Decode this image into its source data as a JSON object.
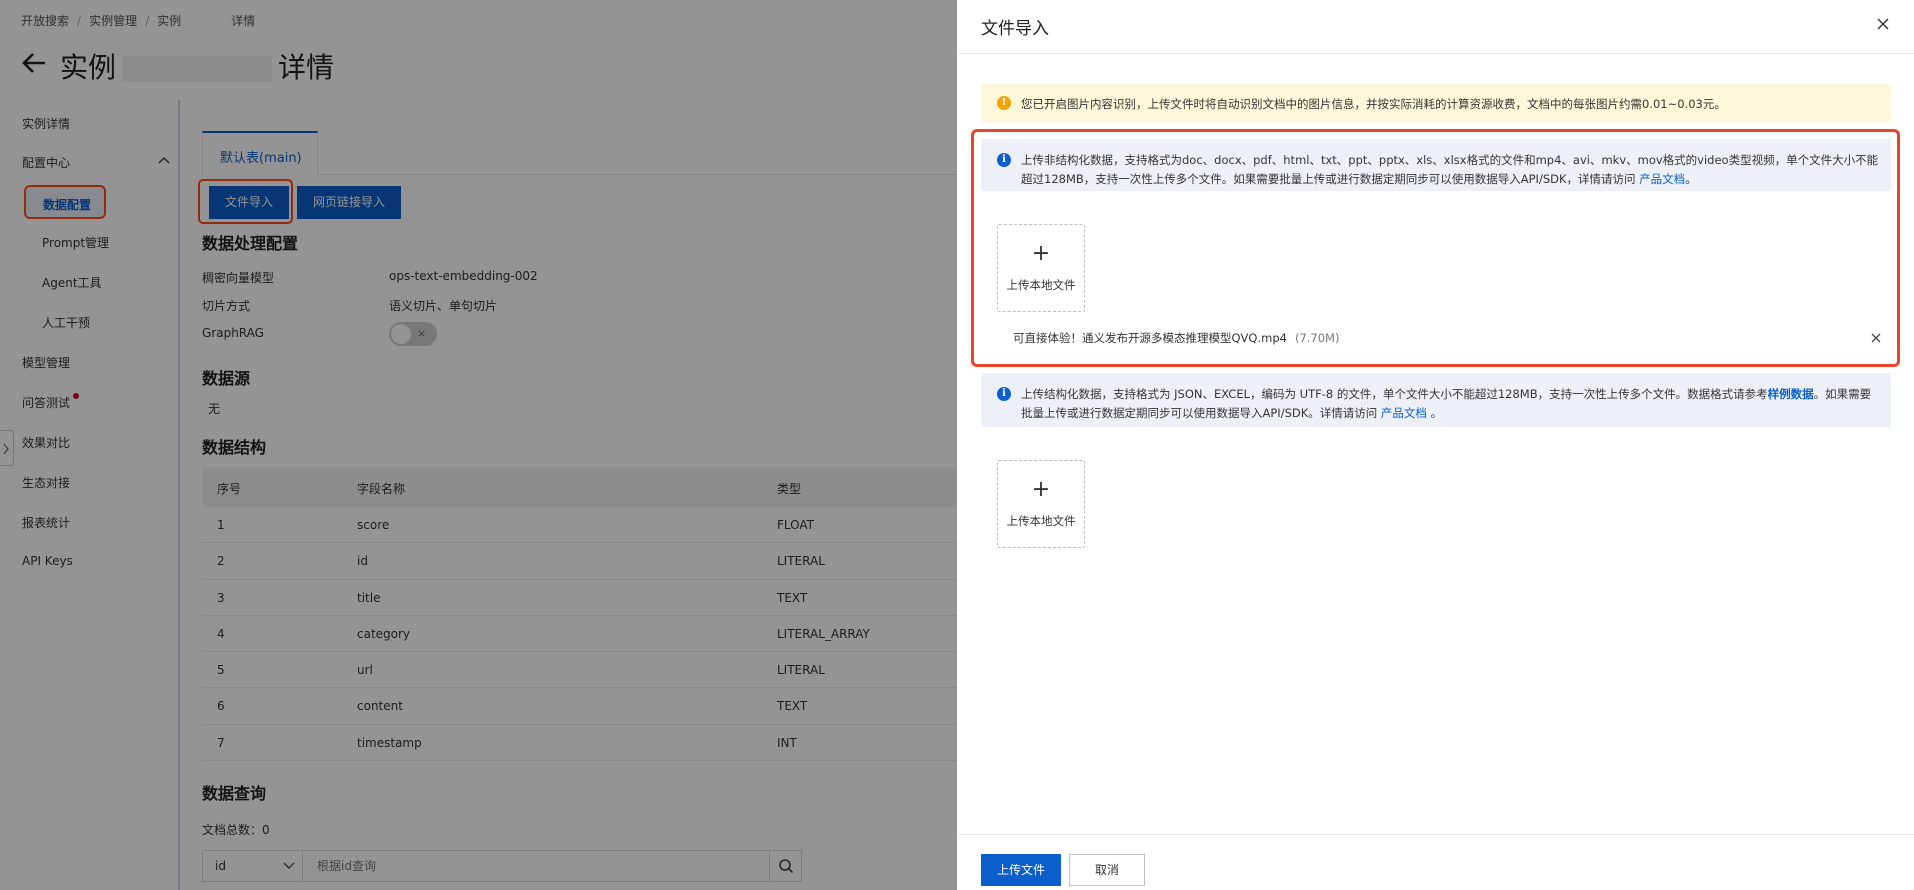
{
  "breadcrumb": [
    "开放搜索",
    "实例管理",
    "实例",
    "详情"
  ],
  "page_title": {
    "prefix": "实例",
    "suffix": "详情"
  },
  "sidebar": {
    "items": [
      {
        "label": "实例详情"
      },
      {
        "label": "配置中心"
      },
      {
        "label": "数据配置"
      },
      {
        "label": "Prompt管理"
      },
      {
        "label": "Agent工具"
      },
      {
        "label": "人工干预"
      },
      {
        "label": "模型管理"
      },
      {
        "label": "问答测试"
      },
      {
        "label": "效果对比"
      },
      {
        "label": "生态对接"
      },
      {
        "label": "报表统计"
      },
      {
        "label": "API Keys"
      }
    ]
  },
  "tabs": {
    "main": "默认表(main)"
  },
  "toolbar": {
    "file_import": "文件导入",
    "web_import": "网页链接导入"
  },
  "processing": {
    "title": "数据处理配置",
    "rows": [
      {
        "label": "稠密向量模型",
        "value": "ops-text-embedding-002"
      },
      {
        "label": "切片方式",
        "value": "语义切片、单句切片"
      },
      {
        "label": "GraphRAG",
        "value": ""
      }
    ],
    "switch_off_glyph": "×"
  },
  "datasource": {
    "title": "数据源",
    "value": "无"
  },
  "structure": {
    "title": "数据结构",
    "columns": [
      "序号",
      "字段名称",
      "类型"
    ],
    "rows": [
      [
        "1",
        "score",
        "FLOAT"
      ],
      [
        "2",
        "id",
        "LITERAL"
      ],
      [
        "3",
        "title",
        "TEXT"
      ],
      [
        "4",
        "category",
        "LITERAL_ARRAY"
      ],
      [
        "5",
        "url",
        "LITERAL"
      ],
      [
        "6",
        "content",
        "TEXT"
      ],
      [
        "7",
        "timestamp",
        "INT"
      ]
    ]
  },
  "query": {
    "title": "数据查询",
    "doc_count_label": "文档总数：0",
    "select_value": "id",
    "input_placeholder": "根据id查询"
  },
  "drawer": {
    "title": "文件导入",
    "warning": "您已开启图片内容识别，上传文件时将自动识别文档中的图片信息，并按实际消耗的计算资源收费，文档中的每张图片约需0.01~0.03元。",
    "unstructured": {
      "text": "上传非结构化数据，支持格式为doc、docx、pdf、html、txt、ppt、pptx、xls、xlsx格式的文件和mp4、avi、mkv、mov格式的video类型视频，单个文件大小不能超过128MB，支持一次性上传多个文件。如果需要批量上传或进行数据定期同步可以使用数据导入API/SDK，详情请访问",
      "link": "产品文档",
      "end": "。"
    },
    "upload_label": "上传本地文件",
    "upload_plus": "+",
    "file": {
      "name": "可直接体验！通义发布开源多模态推理模型QVQ.mp4",
      "size": "(7.70M)"
    },
    "structured": {
      "text": "上传结构化数据，支持格式为 JSON、EXCEL，编码为 UTF-8 的文件，单个文件大小不能超过128MB，支持一次性上传多个文件。数据格式请参考",
      "sample_link": "样例数据",
      "text2": "。如果需要批量上传或进行数据定期同步可以使用数据导入API/SDK。详情请访问 ",
      "link": "产品文档",
      "end": " 。"
    },
    "footer": {
      "upload": "上传文件",
      "cancel": "取消"
    }
  },
  "colors": {
    "primary": "#0b5ecb",
    "highlight": "#ff4a1a",
    "warning_bg": "#fff7d9",
    "info_bg": "#edf1f7"
  }
}
